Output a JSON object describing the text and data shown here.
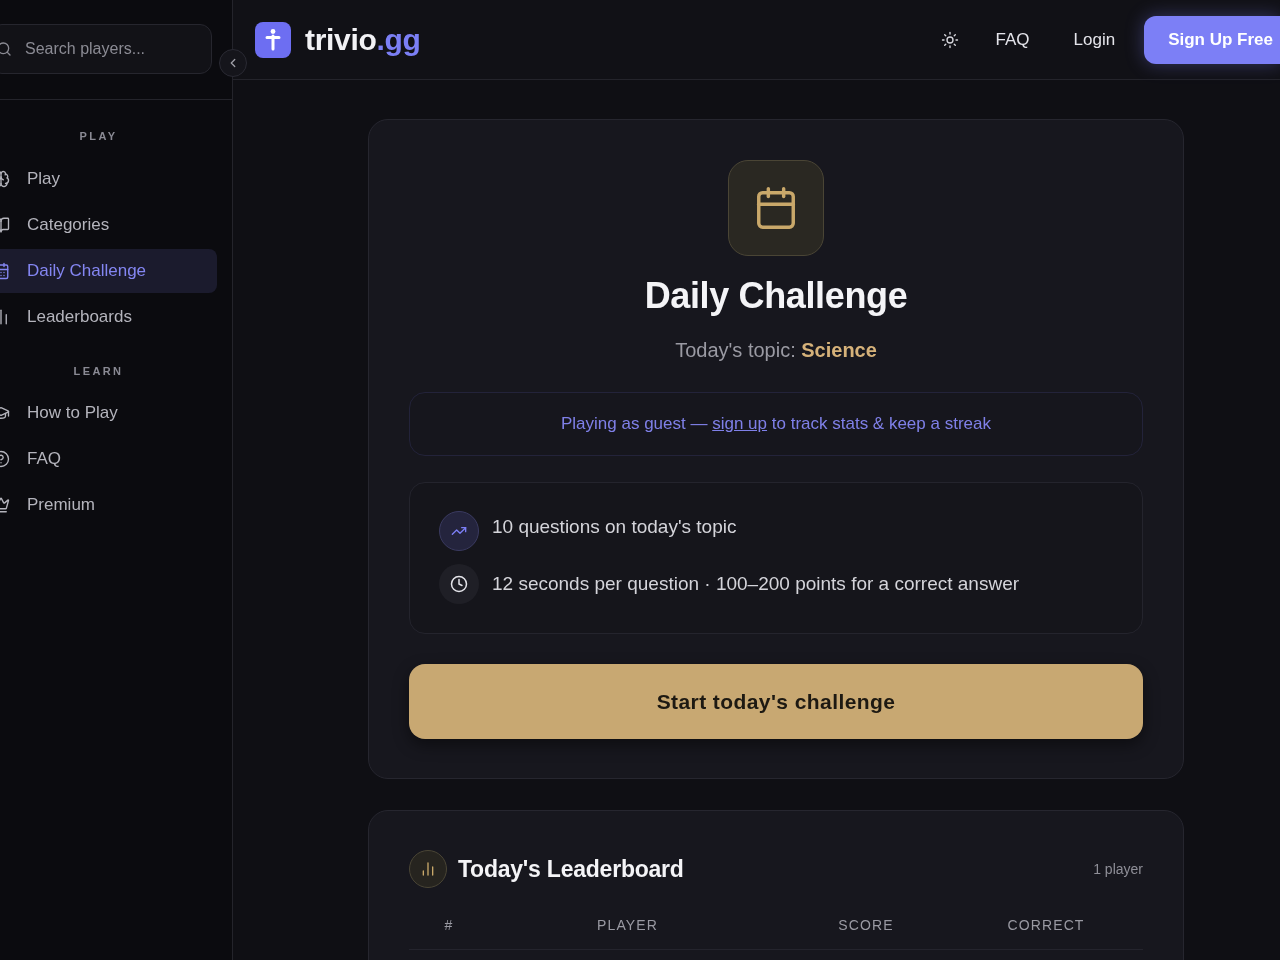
{
  "sidebar": {
    "search": {
      "placeholder": "Search players..."
    },
    "sections": [
      {
        "heading": "PLAY",
        "items": [
          {
            "label": "Play",
            "selected": false
          },
          {
            "label": "Categories",
            "selected": false
          },
          {
            "label": "Daily Challenge",
            "selected": true
          },
          {
            "label": "Leaderboards",
            "selected": false
          }
        ]
      },
      {
        "heading": "LEARN",
        "items": [
          {
            "label": "How to Play",
            "selected": false
          },
          {
            "label": "FAQ",
            "selected": false
          },
          {
            "label": "Premium",
            "selected": false
          }
        ]
      }
    ]
  },
  "header": {
    "logo": {
      "name": "trivio",
      "suffix": ".gg"
    },
    "links": [
      "FAQ",
      "Login"
    ],
    "cta": "Sign Up Free"
  },
  "challenge": {
    "title": "Daily Challenge",
    "topic_label": "Today's topic:",
    "topic": "Science",
    "guest_notice": {
      "before": "Playing as guest —",
      "link": "sign up",
      "after": "to track stats & keep a streak"
    },
    "rules": [
      {
        "kind": "questions",
        "text": "10 questions on today's topic"
      },
      {
        "kind": "timer",
        "text": "12 seconds per question · 100–200 points for a correct answer"
      }
    ],
    "start_button": "Start today's challenge"
  },
  "leaderboard": {
    "title": "Today's Leaderboard",
    "count": "1 player",
    "columns": [
      "#",
      "PLAYER",
      "SCORE",
      "CORRECT"
    ]
  }
}
